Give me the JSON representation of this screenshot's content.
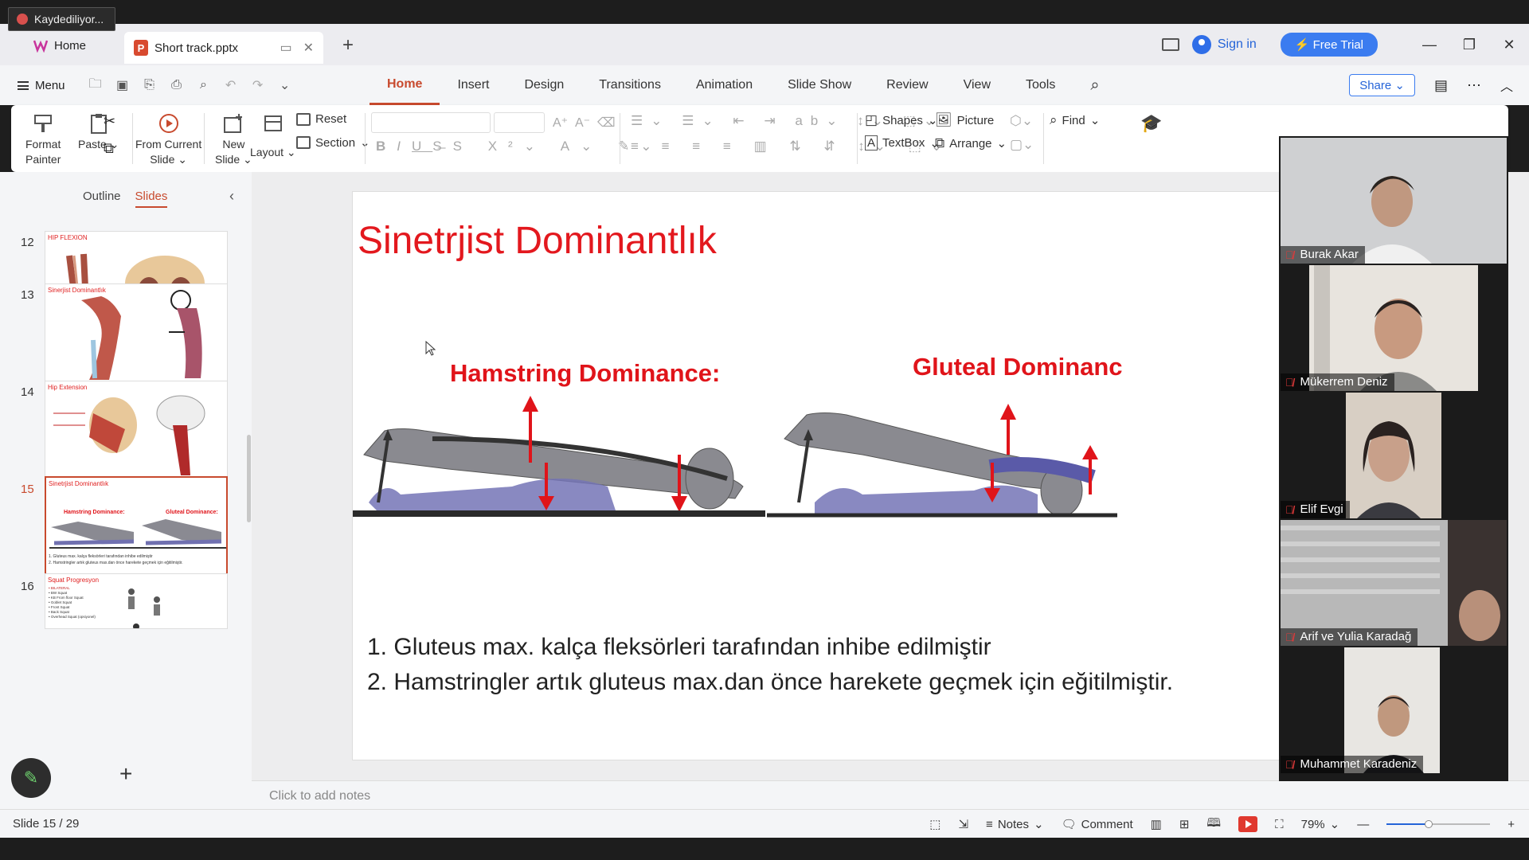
{
  "recording": {
    "label": "Kaydediliyor..."
  },
  "tabs": [
    {
      "label": "Home"
    },
    {
      "label": "Short track.pptx"
    }
  ],
  "topright": {
    "signin": "Sign in",
    "free_trial": "Free Trial"
  },
  "menu": {
    "label": "Menu",
    "ribbon_tabs": [
      "Home",
      "Insert",
      "Design",
      "Transitions",
      "Animation",
      "Slide Show",
      "Review",
      "View",
      "Tools"
    ],
    "active_tab": "Home",
    "share": "Share"
  },
  "ribbon": {
    "format_painter": "Format Painter",
    "format_painter_l1": "Format",
    "format_painter_l2": "Painter",
    "paste": "Paste",
    "from_current_l1": "From Current",
    "from_current_l2": "Slide",
    "new_slide_l1": "New",
    "new_slide_l2": "Slide",
    "layout": "Layout",
    "reset": "Reset",
    "section": "Section",
    "shapes": "Shapes",
    "picture": "Picture",
    "textbox": "TextBox",
    "arrange": "Arrange",
    "find": "Find"
  },
  "left_panel": {
    "tab_outline": "Outline",
    "tab_slides": "Slides",
    "thumbnails": [
      {
        "num": "12",
        "title": "HIP FLEXION"
      },
      {
        "num": "13",
        "title": "Sinerjist Dominantlık"
      },
      {
        "num": "14",
        "title": "Hip Extension"
      },
      {
        "num": "15",
        "title": "Sinetrjist Dominantlık",
        "l1": "Hamstring Dominance:",
        "l2": "Gluteal Dominance:",
        "b1": "1. Gluteus max. kalça fleksörleri tarafından inhibe edilmiştir",
        "b2": "2. Hamstringler artık gluteus max.dan önce harekete geçmek için eğitilmiştir."
      },
      {
        "num": "16",
        "title": "Squat Progresyon",
        "items": [
          "• BILATERAL",
          "• BW Squat",
          "• KB From floor Squat",
          "• Goblet Squat",
          "• Front Squat",
          "• Back Squat",
          "• Overhead Squat (opsiyonel)"
        ]
      }
    ]
  },
  "slide": {
    "title": "Sinetrjist Dominantlık",
    "label_left": "Hamstring Dominance:",
    "label_right": "Gluteal Dominanc",
    "bullets": [
      "1. Gluteus max. kalça fleksörleri tarafından inhibe edilmiştir",
      "2. Hamstringler artık gluteus max.dan önce harekete geçmek için eğitilmiştir."
    ]
  },
  "notes_placeholder": "Click to add notes",
  "participants": [
    {
      "name": "Burak Akar"
    },
    {
      "name": "Mükerrem Deniz"
    },
    {
      "name": "Elif Evgi"
    },
    {
      "name": "Arif ve Yulia Karadağ"
    },
    {
      "name": "Muhammet Karadeniz"
    }
  ],
  "status": {
    "slide_indicator": "Slide 15 / 29",
    "notes": "Notes",
    "comment": "Comment",
    "zoom": "79%"
  },
  "colors": {
    "accent": "#c84a2e",
    "title_red": "#e3181e",
    "link_blue": "#2564d8"
  }
}
